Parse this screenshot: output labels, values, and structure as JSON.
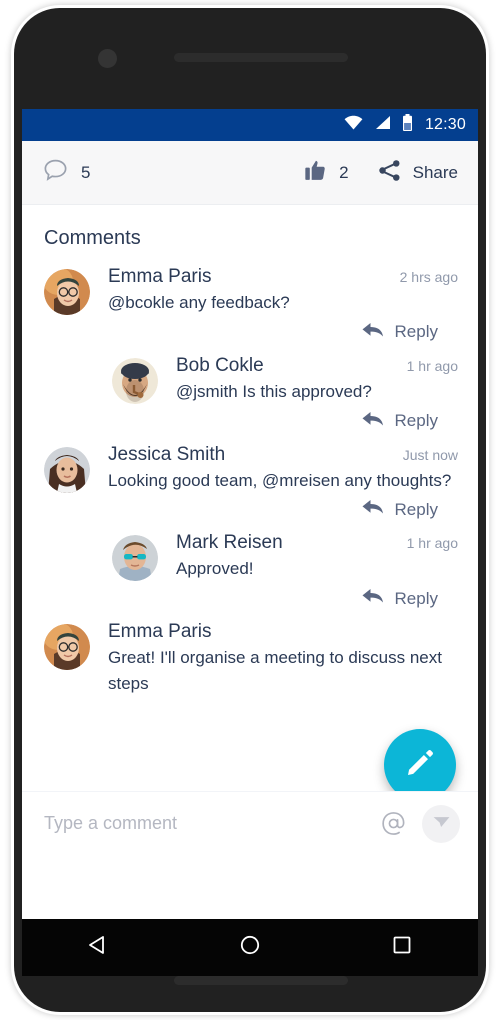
{
  "status_bar": {
    "time": "12:30",
    "icons": [
      "wifi-icon",
      "cellular-signal-icon",
      "battery-icon"
    ],
    "background_color": "#043f8f"
  },
  "action_bar": {
    "comment_icon": "comment-bubble-icon",
    "comment_count": "5",
    "like_icon": "thumbs-up-icon",
    "like_count": "2",
    "share_icon": "share-nodes-icon",
    "share_label": "Share"
  },
  "comments_section": {
    "title": "Comments",
    "reply_label": "Reply",
    "reply_icon": "reply-arrow-icon",
    "comments": [
      {
        "name": "Emma Paris",
        "time": "2 hrs ago",
        "text": "@bcokle  any feedback?",
        "indented": false,
        "avatar": "emma-paris-avatar"
      },
      {
        "name": "Bob Cokle",
        "time": "1 hr ago",
        "text": "@jsmith  Is this approved?",
        "indented": true,
        "avatar": "bob-cokle-avatar"
      },
      {
        "name": "Jessica Smith",
        "time": "Just now",
        "text": "Looking good team, @mreisen any thoughts?",
        "indented": false,
        "avatar": "jessica-smith-avatar"
      },
      {
        "name": "Mark Reisen",
        "time": "1 hr ago",
        "text": "Approved!",
        "indented": true,
        "avatar": "mark-reisen-avatar"
      },
      {
        "name": "Emma Paris",
        "time": "",
        "text": "Great! I'll organise a meeting to discuss next steps",
        "indented": false,
        "avatar": "emma-paris-avatar"
      }
    ]
  },
  "fab": {
    "icon": "pencil-icon",
    "color": "#0cb6d7"
  },
  "input_bar": {
    "placeholder": "Type a comment",
    "value": "",
    "mention_icon": "at-mention-icon",
    "send_icon": "send-paper-plane-icon"
  },
  "nav_bar": {
    "back_icon": "back-triangle-icon",
    "home_icon": "home-circle-icon",
    "recents_icon": "recents-square-icon"
  }
}
